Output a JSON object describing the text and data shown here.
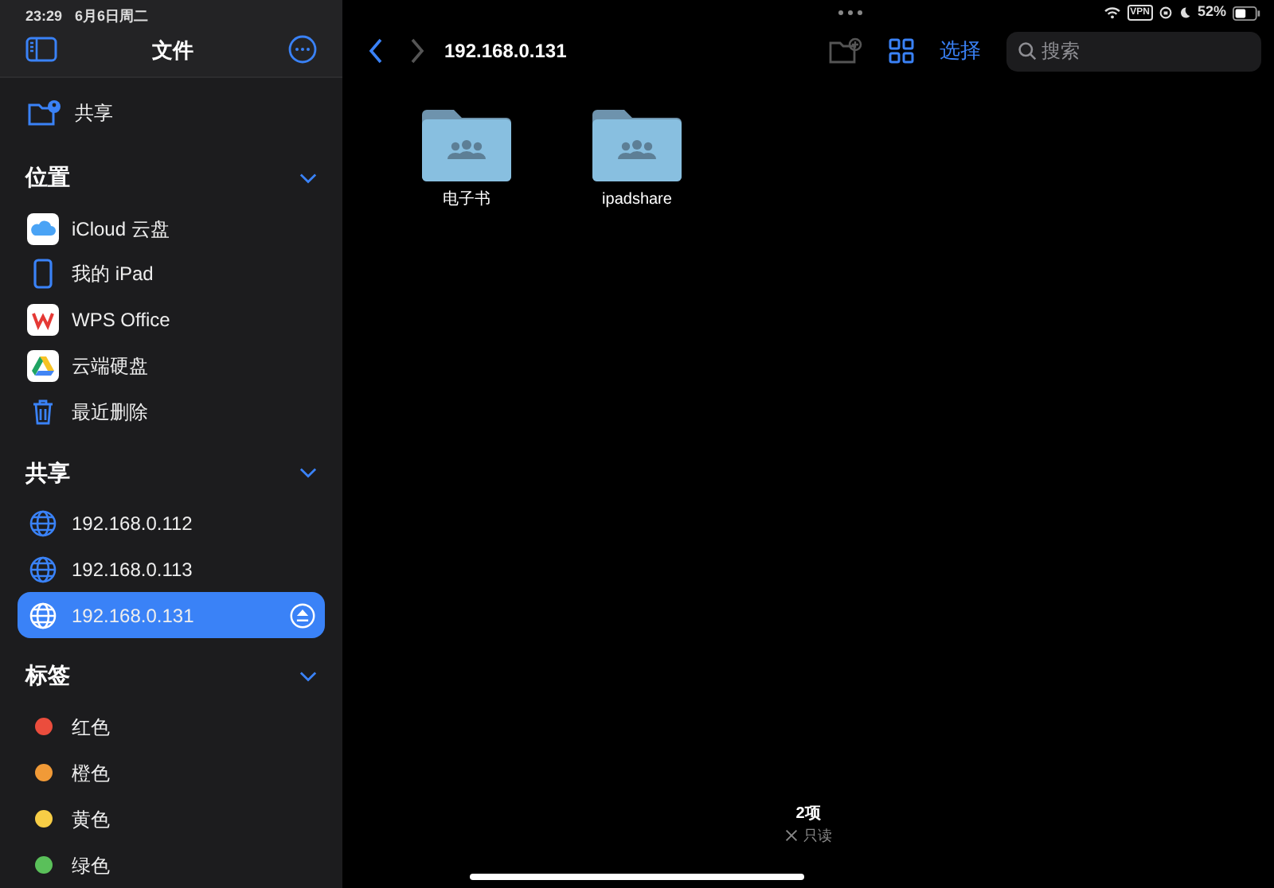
{
  "status_bar": {
    "time": "23:29",
    "date": "6月6日周二",
    "vpn": "VPN",
    "battery": "52%"
  },
  "sidebar": {
    "title": "文件",
    "top_item": {
      "label": "共享"
    },
    "sections": [
      {
        "title": "位置",
        "expanded": true,
        "items": [
          {
            "kind": "icloud",
            "label": "iCloud 云盘",
            "selected": false
          },
          {
            "kind": "ipad",
            "label": "我的 iPad",
            "selected": false
          },
          {
            "kind": "wps",
            "label": "WPS Office",
            "selected": false
          },
          {
            "kind": "drive",
            "label": "云端硬盘",
            "selected": false
          },
          {
            "kind": "trash",
            "label": "最近删除",
            "selected": false
          }
        ]
      },
      {
        "title": "共享",
        "expanded": true,
        "items": [
          {
            "kind": "server",
            "label": "192.168.0.112",
            "selected": false
          },
          {
            "kind": "server",
            "label": "192.168.0.113",
            "selected": false
          },
          {
            "kind": "server",
            "label": "192.168.0.131",
            "selected": true
          }
        ]
      },
      {
        "title": "标签",
        "expanded": true,
        "items": [
          {
            "kind": "tag",
            "label": "红色",
            "color": "#eb4d3d",
            "selected": false
          },
          {
            "kind": "tag",
            "label": "橙色",
            "color": "#f19a37",
            "selected": false
          },
          {
            "kind": "tag",
            "label": "黄色",
            "color": "#f7cd46",
            "selected": false
          },
          {
            "kind": "tag",
            "label": "绿色",
            "color": "#5ac05a",
            "selected": false
          }
        ]
      }
    ]
  },
  "toolbar": {
    "title": "192.168.0.131",
    "select": "选择",
    "search": {
      "placeholder": "搜索"
    }
  },
  "folders": [
    {
      "name": "电子书"
    },
    {
      "name": "ipadshare"
    }
  ],
  "footer": {
    "count": "2项",
    "mode": "只读"
  }
}
